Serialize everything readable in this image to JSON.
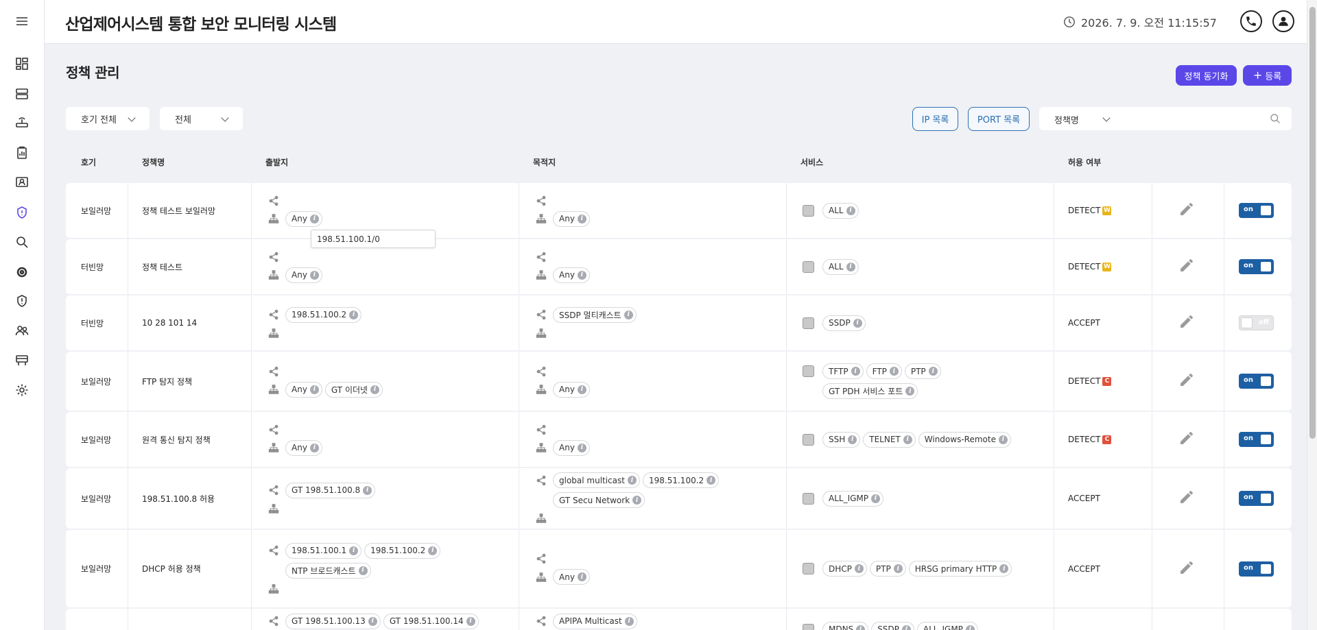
{
  "header": {
    "title": "산업제어시스템 통합 보안 모니터링 시스템",
    "datetime": "2026. 7. 9. 오전 11:15:57"
  },
  "sidebar": {
    "items": [
      {
        "icon": "menu-icon"
      },
      {
        "icon": "dashboard-icon"
      },
      {
        "icon": "server-icon"
      },
      {
        "icon": "router-icon"
      },
      {
        "icon": "report-icon"
      },
      {
        "icon": "monitor-user-icon"
      },
      {
        "icon": "shield-policy-icon",
        "active": true
      },
      {
        "icon": "search-icon"
      },
      {
        "icon": "settings-gear-icon"
      },
      {
        "icon": "shield-alert-icon"
      },
      {
        "icon": "users-icon"
      },
      {
        "icon": "board-icon"
      },
      {
        "icon": "settings-icon"
      }
    ]
  },
  "page": {
    "title": "정책 관리",
    "sync_label": "정책 동기화",
    "add_label": "등록"
  },
  "filters": {
    "unit": "호기 전체",
    "status": "전체",
    "ip_list": "IP 목록",
    "port_list": "PORT 목록",
    "search_field": "정책명",
    "search_value": ""
  },
  "table": {
    "headers": [
      "호기",
      "정책명",
      "출발지",
      "목적지",
      "서비스",
      "허용 여부"
    ],
    "rows": [
      {
        "unit": "보일러망",
        "name": "정책 테스트 보일러망",
        "src": {
          "net": [],
          "host": [
            "Any"
          ]
        },
        "dst": {
          "net": [],
          "host": [
            "Any"
          ]
        },
        "services": [
          "ALL"
        ],
        "allow": "DETECT",
        "badge": "W",
        "enabled": "on"
      },
      {
        "unit": "터빈망",
        "name": "정책 테스트",
        "src": {
          "net": [],
          "host": [
            "Any"
          ]
        },
        "dst": {
          "net": [],
          "host": [
            "Any"
          ]
        },
        "services": [
          "ALL"
        ],
        "allow": "DETECT",
        "badge": "W",
        "enabled": "on"
      },
      {
        "unit": "터빈망",
        "name": "10 28 101 14",
        "src": {
          "net": [
            "198.51.100.2"
          ],
          "host": []
        },
        "dst": {
          "net": [
            "SSDP 멀티캐스트"
          ],
          "host": []
        },
        "services": [
          "SSDP"
        ],
        "allow": "ACCEPT",
        "badge": "",
        "enabled": "off"
      },
      {
        "unit": "보일러망",
        "name": "FTP 탐지 정책",
        "src": {
          "net": [],
          "host": [
            "Any",
            "GT 이더넷"
          ]
        },
        "dst": {
          "net": [],
          "host": [
            "Any"
          ]
        },
        "services": [
          "TFTP",
          "FTP",
          "PTP",
          "GT PDH 서비스 포트"
        ],
        "allow": "DETECT",
        "badge": "C",
        "enabled": "on"
      },
      {
        "unit": "보일러망",
        "name": "원격 통신 탐지 정책",
        "src": {
          "net": [],
          "host": [
            "Any"
          ]
        },
        "dst": {
          "net": [],
          "host": [
            "Any"
          ]
        },
        "services": [
          "SSH",
          "TELNET",
          "Windows-Remote"
        ],
        "allow": "DETECT",
        "badge": "C",
        "enabled": "on"
      },
      {
        "unit": "보일러망",
        "name": "198.51.100.8 허용",
        "src": {
          "net": [
            "GT 198.51.100.8"
          ],
          "host": []
        },
        "dst": {
          "net": [
            "global multicast",
            "198.51.100.2",
            "GT Secu Network"
          ],
          "host": []
        },
        "services": [
          "ALL_IGMP"
        ],
        "allow": "ACCEPT",
        "badge": "",
        "enabled": "on"
      },
      {
        "unit": "보일러망",
        "name": "DHCP 허용 정책",
        "src": {
          "net": [
            "198.51.100.1",
            "198.51.100.2",
            "NTP 브로드캐스트"
          ],
          "host": []
        },
        "dst": {
          "net": [],
          "host": [
            "Any"
          ]
        },
        "services": [
          "DHCP",
          "PTP",
          "HRSG primary HTTP"
        ],
        "allow": "ACCEPT",
        "badge": "",
        "enabled": "on"
      },
      {
        "unit": "",
        "name": "",
        "src": {
          "net": [
            "GT 198.51.100.13",
            "GT 198.51.100.14"
          ],
          "host": []
        },
        "dst": {
          "net": [
            "APIPA Multicast"
          ],
          "host": []
        },
        "services": [
          "MDNS",
          "SSDP",
          "ALL_IGMP"
        ],
        "allow": "",
        "badge": "",
        "enabled": ""
      }
    ]
  },
  "tooltip": "198.51.100.1/0"
}
